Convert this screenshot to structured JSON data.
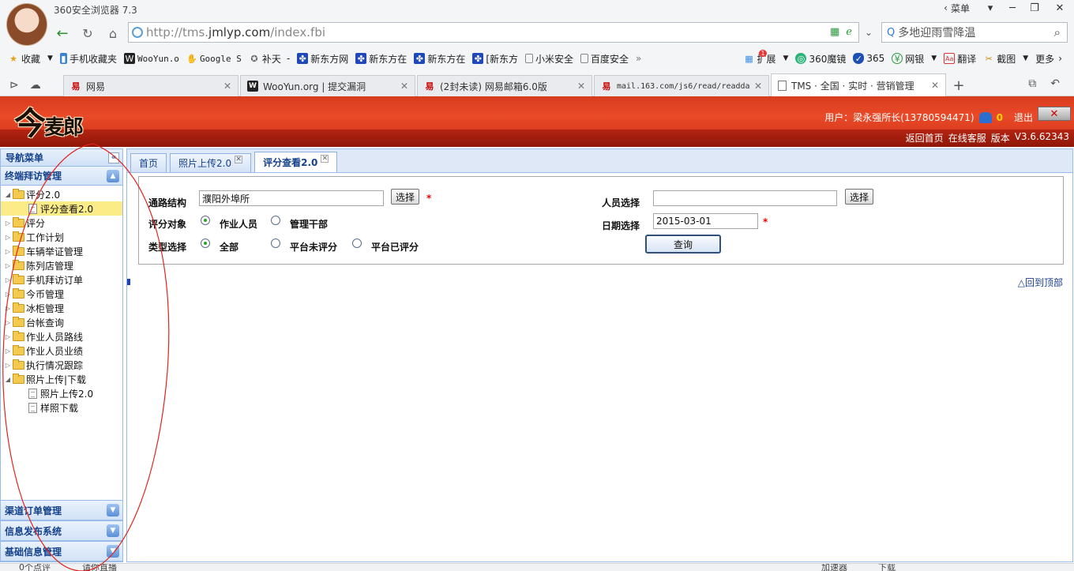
{
  "browser": {
    "app_title": "360安全浏览器 7.3",
    "menu_label": "菜单",
    "url_prefix": "http://tms.",
    "url_domain": "jmlyp.com",
    "url_path": "/index.fbi",
    "search_text": "多地迎雨雪降温",
    "bookmarks": [
      "收藏",
      "手机收藏夹",
      "WooYun.o",
      "Google S",
      "补天",
      "新东方网",
      "新东方在",
      "新东方在",
      "[新东方",
      "小米安全",
      "百度安全"
    ],
    "toolbar_right": [
      "扩展",
      "360魔镜",
      "365",
      "网银",
      "翻译",
      "截图",
      "更多"
    ],
    "ext_badge": "1",
    "tabs": [
      {
        "title": "网易",
        "active": false
      },
      {
        "title": "WooYun.org | 提交漏洞",
        "active": false
      },
      {
        "title": "(2封未读) 网易邮箱6.0版",
        "active": false
      },
      {
        "title": "mail.163.com/js6/read/readda",
        "active": false
      },
      {
        "title": "TMS · 全国 · 实时 · 营销管理",
        "active": true
      }
    ]
  },
  "header": {
    "logo_main": "今",
    "logo_rest": "麦郎",
    "user_label": "用户：梁永强所长(13780594471)",
    "message_count": "0",
    "logout_label": "退出",
    "links": [
      "返回首页",
      "在线客服",
      "版本",
      "V3.6.62343"
    ]
  },
  "sidebar": {
    "title": "导航菜单",
    "active_section": "终端拜访管理",
    "tree": [
      {
        "label": "评分2.0",
        "type": "folder",
        "open": true,
        "level": 0
      },
      {
        "label": "评分查看2.0",
        "type": "file",
        "level": 1,
        "selected": true
      },
      {
        "label": "评分",
        "type": "folder",
        "level": 0
      },
      {
        "label": "工作计划",
        "type": "folder",
        "level": 0
      },
      {
        "label": "车辆举证管理",
        "type": "folder",
        "level": 0
      },
      {
        "label": "陈列店管理",
        "type": "folder",
        "level": 0
      },
      {
        "label": "手机拜访订单",
        "type": "folder",
        "level": 0
      },
      {
        "label": "今币管理",
        "type": "folder",
        "level": 0
      },
      {
        "label": "冰柜管理",
        "type": "folder",
        "level": 0
      },
      {
        "label": "台帐查询",
        "type": "folder",
        "level": 0
      },
      {
        "label": "作业人员路线",
        "type": "folder",
        "level": 0
      },
      {
        "label": "作业人员业绩",
        "type": "folder",
        "level": 0
      },
      {
        "label": "执行情况跟踪",
        "type": "folder",
        "level": 0
      },
      {
        "label": "照片上传|下载",
        "type": "folder",
        "open": true,
        "level": 0
      },
      {
        "label": "照片上传2.0",
        "type": "file",
        "level": 1
      },
      {
        "label": "样照下载",
        "type": "file",
        "level": 1
      }
    ],
    "bottom_sections": [
      "渠道订单管理",
      "信息发布系统",
      "基础信息管理"
    ]
  },
  "content": {
    "tabs": [
      {
        "label": "首页",
        "closable": false,
        "active": false
      },
      {
        "label": "照片上传2.0",
        "closable": true,
        "active": false
      },
      {
        "label": "评分查看2.0",
        "closable": true,
        "active": true
      }
    ],
    "form": {
      "channel_label": "通路结构",
      "channel_value": "濮阳外埠所",
      "select_label": "选择",
      "person_label": "人员选择",
      "person_value": "",
      "target_label": "评分对象",
      "target_options": [
        "作业人员",
        "管理干部"
      ],
      "target_selected": 0,
      "date_label": "日期选择",
      "date_value": "2015-03-01",
      "type_label": "类型选择",
      "type_options": [
        "全部",
        "平台未评分",
        "平台已评分"
      ],
      "type_selected": 0,
      "query_label": "查询",
      "required_mark": "*"
    },
    "back_to_top": "△回到顶部"
  },
  "status_bar": {
    "items": [
      "0个点评",
      "请你直播",
      "加速器",
      "下载"
    ]
  },
  "colors": {
    "header_red": "#e2401f",
    "panel_border": "#99bbe8",
    "panel_title": "#15428b",
    "annotation_red": "#e0241c"
  }
}
